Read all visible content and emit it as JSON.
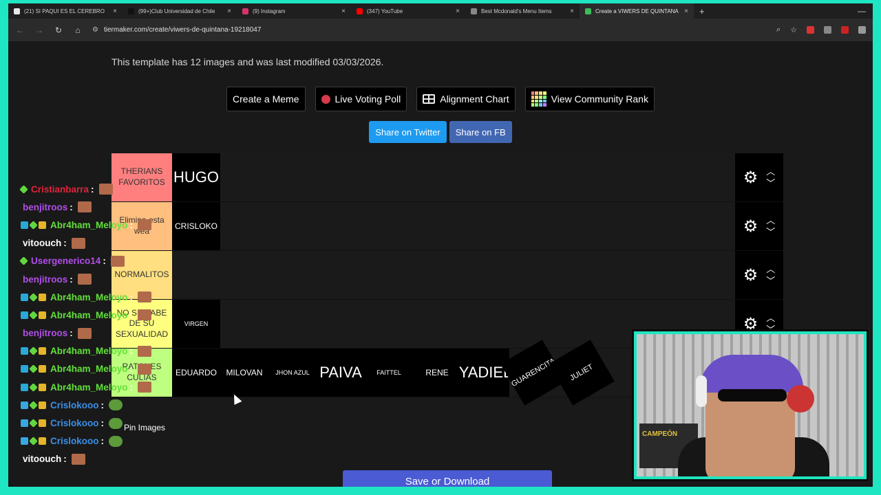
{
  "browser": {
    "tabs": [
      {
        "title": "(21) SI PAQUI ES EL CEREBRO",
        "color": "#e7e7e7",
        "active": false
      },
      {
        "title": "(99+)Club Universidad de Chile",
        "color": "#111111",
        "active": false
      },
      {
        "title": "(9) Instagram",
        "color": "#d6336c",
        "active": false
      },
      {
        "title": "(347) YouTube",
        "color": "#ff0000",
        "active": false
      },
      {
        "title": "Best Mcdonald's Menu Items",
        "color": "#888888",
        "active": false
      },
      {
        "title": "Create a VIWERS DE QUINTANA",
        "color": "#3dbb5b",
        "active": true
      }
    ],
    "new_tab": "+",
    "url": "tiermaker.com/create/viwers-de-quintana-19218047"
  },
  "page": {
    "info": "This template has 12 images and was last modified 03/03/2026.",
    "buttons": {
      "create_meme": "Create a Meme",
      "live_poll": "Live Voting Poll",
      "alignment": "Alignment Chart",
      "community": "View Community Rank"
    },
    "share": {
      "twitter": "Share on Twitter",
      "facebook": "Share on FB"
    },
    "pin_images": "Pin Images",
    "save": "Save or Download"
  },
  "tiers": [
    {
      "label": "THERIANS FAVORITOS",
      "color": "#ff7f7f",
      "items": [
        {
          "text": "HUGO",
          "style": "big"
        }
      ]
    },
    {
      "label": "Elimina esta wea",
      "color": "#ffbf7f",
      "items": [
        {
          "text": "CRISLOKO",
          "style": ""
        }
      ]
    },
    {
      "label": "NORMALITOS",
      "color": "#ffdf7f",
      "items": []
    },
    {
      "label": "NO SE SABE DE SU SEXUALIDAD",
      "color": "#ffff7f",
      "items": [
        {
          "text": "VIRGEN",
          "style": "sm"
        }
      ]
    },
    {
      "label": "RATONES CULIAS",
      "color": "#bfff7f",
      "items": [
        {
          "text": "EDUARDO",
          "style": ""
        },
        {
          "text": "MILOVAN",
          "style": ""
        },
        {
          "text": "JHON AZUL",
          "style": "sm"
        },
        {
          "text": "PAIVA",
          "style": "big"
        },
        {
          "text": "FAITTEL",
          "style": "sm"
        },
        {
          "text": "RENE",
          "style": ""
        },
        {
          "text": "YADIEL",
          "style": "big"
        },
        {
          "text": "GUARENCITA",
          "style": "rot"
        },
        {
          "text": "JULIET",
          "style": "rot"
        }
      ]
    }
  ],
  "chat": [
    {
      "user": "Cristianbarra",
      "color": "#e0243a",
      "badges": [
        "sub"
      ],
      "emote": "face"
    },
    {
      "user": "benjitroos",
      "color": "#b14fe8",
      "badges": [],
      "emote": "face"
    },
    {
      "user": "Abr4ham_Meloyo",
      "color": "#62e03a",
      "badges": [
        "prime",
        "sub",
        "vip"
      ],
      "emote": "face"
    },
    {
      "user": "vitoouch",
      "color": "#ffffff",
      "badges": [],
      "emote": "face"
    },
    {
      "user": "Usergenerico14",
      "color": "#b14fe8",
      "badges": [
        "sub"
      ],
      "emote": "face"
    },
    {
      "user": "benjitroos",
      "color": "#b14fe8",
      "badges": [],
      "emote": "face"
    },
    {
      "user": "Abr4ham_Meloyo",
      "color": "#62e03a",
      "badges": [
        "prime",
        "sub",
        "vip"
      ],
      "emote": "face"
    },
    {
      "user": "Abr4ham_Meloyo",
      "color": "#62e03a",
      "badges": [
        "prime",
        "sub",
        "vip"
      ],
      "emote": "face"
    },
    {
      "user": "benjitroos",
      "color": "#b14fe8",
      "badges": [],
      "emote": "face"
    },
    {
      "user": "Abr4ham_Meloyo",
      "color": "#62e03a",
      "badges": [
        "prime",
        "sub",
        "vip"
      ],
      "emote": "face"
    },
    {
      "user": "Abr4ham_Meloyo",
      "color": "#62e03a",
      "badges": [
        "prime",
        "sub",
        "vip"
      ],
      "emote": "face"
    },
    {
      "user": "Abr4ham_Meloyo",
      "color": "#62e03a",
      "badges": [
        "prime",
        "sub",
        "vip"
      ],
      "emote": "face"
    },
    {
      "user": "Crislokooo",
      "color": "#3b8fe8",
      "badges": [
        "cube",
        "sub",
        "vip"
      ],
      "emote": "frog"
    },
    {
      "user": "Crislokooo",
      "color": "#3b8fe8",
      "badges": [
        "cube",
        "sub",
        "vip"
      ],
      "emote": "frog"
    },
    {
      "user": "Crislokooo",
      "color": "#3b8fe8",
      "badges": [
        "cube",
        "sub",
        "vip"
      ],
      "emote": "frog"
    },
    {
      "user": "vitoouch",
      "color": "#ffffff",
      "badges": [],
      "emote": "face"
    }
  ],
  "webcam": {
    "poster_text": "CAMPEÓN"
  },
  "colors": {
    "frame": "#1ee6c2",
    "twitter": "#1d9bf0",
    "facebook": "#4267b2",
    "save": "#4a5bd4"
  }
}
